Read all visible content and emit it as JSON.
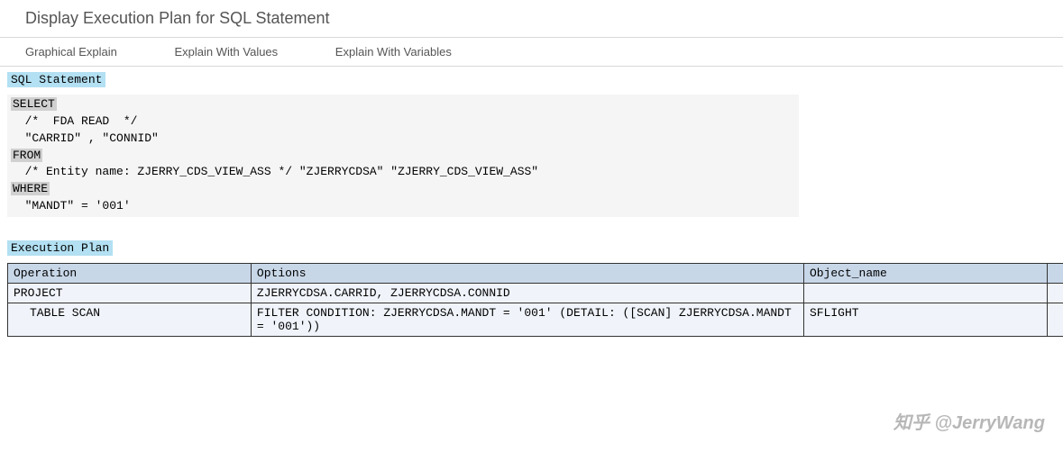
{
  "header": {
    "title": "Display Execution Plan for SQL Statement"
  },
  "tabs": [
    {
      "label": "Graphical Explain"
    },
    {
      "label": "Explain With Values"
    },
    {
      "label": "Explain With Variables"
    }
  ],
  "sql": {
    "section_label": "SQL Statement",
    "keyword_select": "SELECT",
    "line_fda": "  /*  FDA READ  */",
    "line_cols": "  \"CARRID\" , \"CONNID\"",
    "keyword_from": "FROM",
    "line_from_body": "  /* Entity name: ZJERRY_CDS_VIEW_ASS */ \"ZJERRYCDSA\" \"ZJERRY_CDS_VIEW_ASS\"",
    "keyword_where": "WHERE",
    "line_where_body": "  \"MANDT\" = '001'"
  },
  "execution_plan": {
    "section_label": "Execution Plan",
    "columns": {
      "operation": "Operation",
      "options": "Options",
      "object_name": "Object_name"
    },
    "rows": [
      {
        "operation": "PROJECT",
        "options": "ZJERRYCDSA.CARRID, ZJERRYCDSA.CONNID",
        "object_name": ""
      },
      {
        "operation": "  TABLE SCAN",
        "options": "FILTER CONDITION: ZJERRYCDSA.MANDT = '001' (DETAIL: ([SCAN] ZJERRYCDSA.MANDT = '001'))",
        "object_name": "SFLIGHT"
      }
    ]
  },
  "watermark": "知乎 @JerryWang"
}
